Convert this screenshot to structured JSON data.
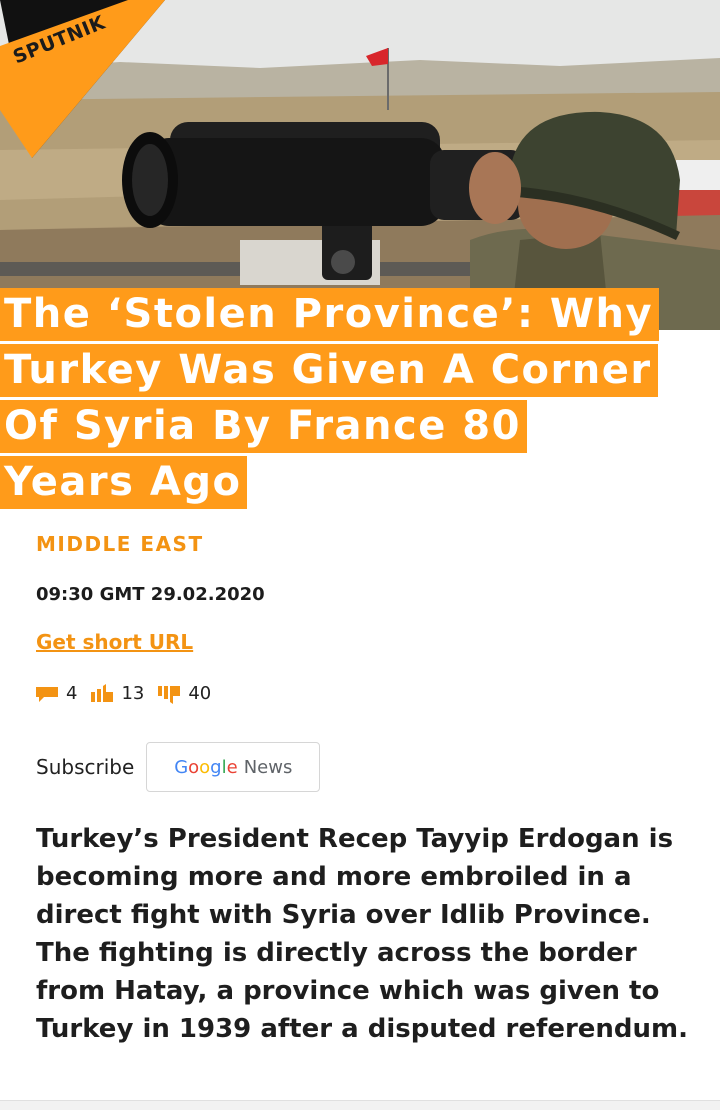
{
  "brand": {
    "logo_text": "SPUTNIK",
    "accent_color": "#ff9b1a"
  },
  "hero": {
    "image_subject": "soldier looking through large binoculars on a border post with a Turkish flag in the distance"
  },
  "headline": {
    "lines": [
      "The ‘Stolen Province’: Why",
      "Turkey Was Given A Corner",
      "Of Syria By France 80",
      "Years Ago"
    ]
  },
  "section": "MIDDLE EAST",
  "timestamp": "09:30 GMT 29.02.2020",
  "short_url_label": "Get short URL",
  "counters": {
    "comments": "4",
    "likes": "13",
    "dislikes": "40"
  },
  "subscribe": {
    "label": "Subscribe",
    "button_brand": "Google",
    "button_product": "News"
  },
  "body": "Turkey’s President Recep Tayyip Erdogan is becoming more and more embroiled in a direct fight with Syria over Idlib Province. The fighting is directly across the border from Hatay, a province which was given to Turkey in 1939 after a disputed referendum."
}
